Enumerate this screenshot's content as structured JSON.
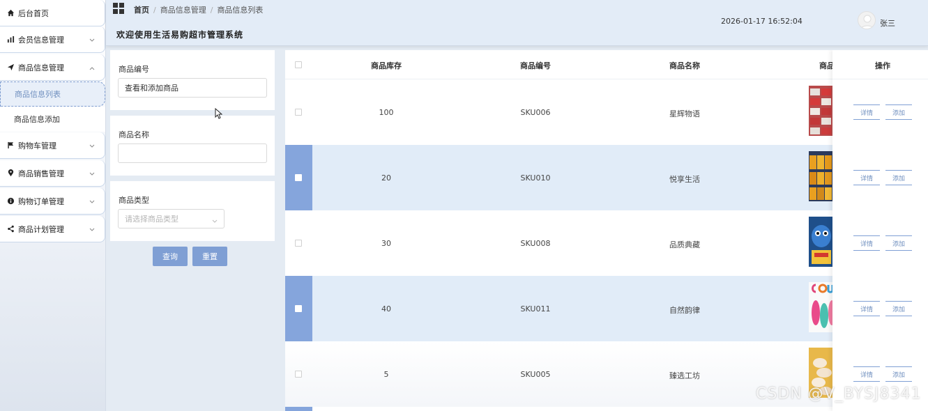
{
  "sidebar": {
    "items": [
      {
        "label": "后台首页",
        "icon": "home-icon"
      },
      {
        "label": "会员信息管理",
        "icon": "bar-chart-icon"
      },
      {
        "label": "商品信息管理",
        "icon": "paper-plane-icon"
      },
      {
        "label": "购物车管理",
        "icon": "flag-icon"
      },
      {
        "label": "商品销售管理",
        "icon": "location-pin-icon"
      },
      {
        "label": "购物订单管理",
        "icon": "info-icon"
      },
      {
        "label": "商品计划管理",
        "icon": "share-icon"
      }
    ],
    "sub_items": [
      {
        "label": "商品信息列表",
        "active": true
      },
      {
        "label": "商品信息添加",
        "active": false
      }
    ]
  },
  "header": {
    "breadcrumb": [
      "首页",
      "商品信息管理",
      "商品信息列表"
    ],
    "title": "欢迎使用生活易购超市管理系统",
    "datetime": "2026-01-17 16:52:04",
    "username": "张三"
  },
  "filter": {
    "code_label": "商品编号",
    "code_value": "查看和添加商品",
    "name_label": "商品名称",
    "name_value": "",
    "type_label": "商品类型",
    "type_placeholder": "请选择商品类型",
    "query_label": "查询",
    "reset_label": "重置"
  },
  "table": {
    "columns": [
      "商品库存",
      "商品编号",
      "商品名称",
      "商品",
      "操作"
    ],
    "rows": [
      {
        "stock": "100",
        "code": "SKU006",
        "name": "星辉物语",
        "selected": false
      },
      {
        "stock": "20",
        "code": "SKU010",
        "name": "悦享生活",
        "selected": true
      },
      {
        "stock": "30",
        "code": "SKU008",
        "name": "品质典藏",
        "selected": false
      },
      {
        "stock": "40",
        "code": "SKU011",
        "name": "自然韵律",
        "selected": true
      },
      {
        "stock": "5",
        "code": "SKU005",
        "name": "臻选工坊",
        "selected": false
      }
    ],
    "detail_label": "详情",
    "add_label": "添加"
  },
  "watermark": "CSDN @V_BYSJ8341",
  "colors": {
    "accent": "#7f9fd4",
    "selected_row": "#e1ecf8",
    "header_bg": "#e3ecf7"
  }
}
